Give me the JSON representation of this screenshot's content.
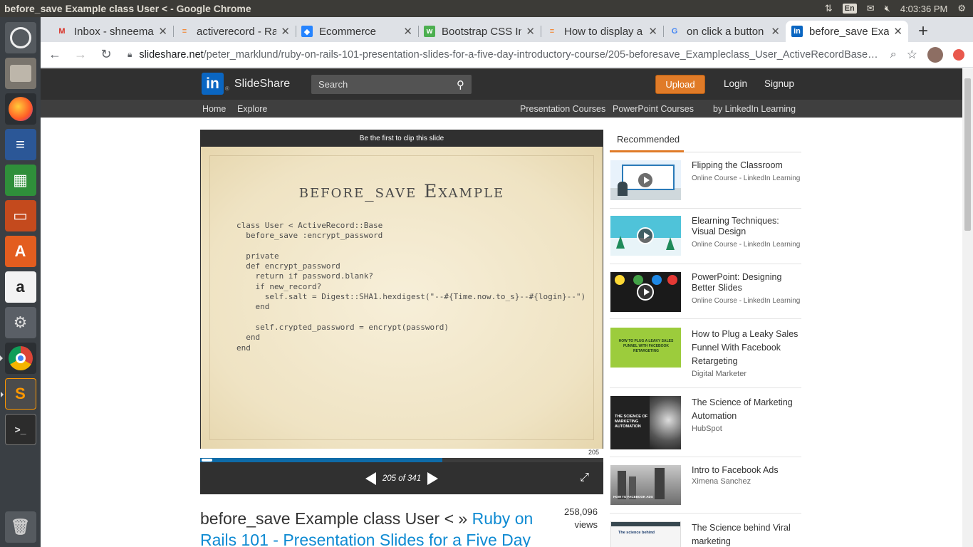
{
  "os": {
    "window_title": "before_save Example class User < - Google Chrome",
    "keyboard_layout": "En",
    "clock": "4:03:36 PM"
  },
  "launcher": [
    "ubuntu-dash-icon",
    "files-icon",
    "firefox-icon",
    "writer-icon",
    "calc-icon",
    "impress-icon",
    "software-center-icon",
    "amazon-icon",
    "settings-icon",
    "chrome-icon",
    "sublime-text-icon",
    "terminal-icon",
    "trash-icon"
  ],
  "tabs": [
    {
      "label": "Inbox - shneema",
      "icon": "gmail-icon"
    },
    {
      "label": "activerecord - Ra",
      "icon": "stackoverflow-icon"
    },
    {
      "label": "Ecommerce",
      "icon": "jira-icon"
    },
    {
      "label": "Bootstrap CSS In",
      "icon": "w3schools-icon"
    },
    {
      "label": "How to display a",
      "icon": "stackoverflow-icon"
    },
    {
      "label": "on click a button",
      "icon": "google-icon"
    },
    {
      "label": "before_save Exa",
      "icon": "linkedin-icon",
      "active": true
    }
  ],
  "address_bar": {
    "host": "slideshare.net",
    "path": "/peter_marklund/ruby-on-rails-101-presentation-slides-for-a-five-day-introductory-course/205-beforesave_Exampleclass_User_ActiveRecordBase…"
  },
  "slideshare": {
    "brand": "SlideShare",
    "search_placeholder": "Search",
    "upload": "Upload",
    "login": "Login",
    "signup": "Signup",
    "nav": {
      "home": "Home",
      "explore": "Explore",
      "presentation_courses": "Presentation Courses",
      "powerpoint_courses": "PowerPoint Courses",
      "by_linkedin": "by LinkedIn Learning"
    },
    "accent": "#e07b28"
  },
  "viewer": {
    "clip_text": "Be the first to clip this slide",
    "slide_title": "before_save Example",
    "code": "class User < ActiveRecord::Base\n  before_save :encrypt_password\n\n  private\n  def encrypt_password\n    return if password.blank?\n    if new_record?\n      self.salt = Digest::SHA1.hexdigest(\"--#{Time.now.to_s}--#{login}--\")\n    end\n\n    self.crypted_password = encrypt(password)\n  end\nend",
    "slide_number": "205",
    "page_counter": "205 of 341",
    "progress_fraction": 0.6
  },
  "deck": {
    "title_prefix": "before_save Example class User < » ",
    "title_link": "Ruby on Rails 101 - Presentation Slides for a Five Day",
    "views_count": "258,096",
    "views_label": "views"
  },
  "recommended": {
    "heading": "Recommended",
    "items": [
      {
        "title": "Flipping the Classroom",
        "sub": "Online Course - LinkedIn Learning"
      },
      {
        "title": "Elearning Techniques: Visual Design",
        "sub": "Online Course - LinkedIn Learning"
      },
      {
        "title": "PowerPoint: Designing Better Slides",
        "sub": "Online Course - LinkedIn Learning"
      },
      {
        "title": "How to Plug a Leaky Sales Funnel With Facebook Retargeting",
        "sub": "Digital Marketer",
        "thumb_text": "HOW TO PLUG A LEAKY SALES FUNNEL WITH FACEBOOK RETARGETING"
      },
      {
        "title": "The Science of Marketing Automation",
        "sub": "HubSpot",
        "thumb_text": "THE SCIENCE OF MARKETING AUTOMATION"
      },
      {
        "title": "Intro to Facebook Ads",
        "sub": "Ximena Sanchez",
        "thumb_text": "HOW TO FACEBOOK ADS"
      },
      {
        "title": "The Science behind Viral marketing",
        "sub": "",
        "thumb_text": "The science behind"
      }
    ]
  }
}
